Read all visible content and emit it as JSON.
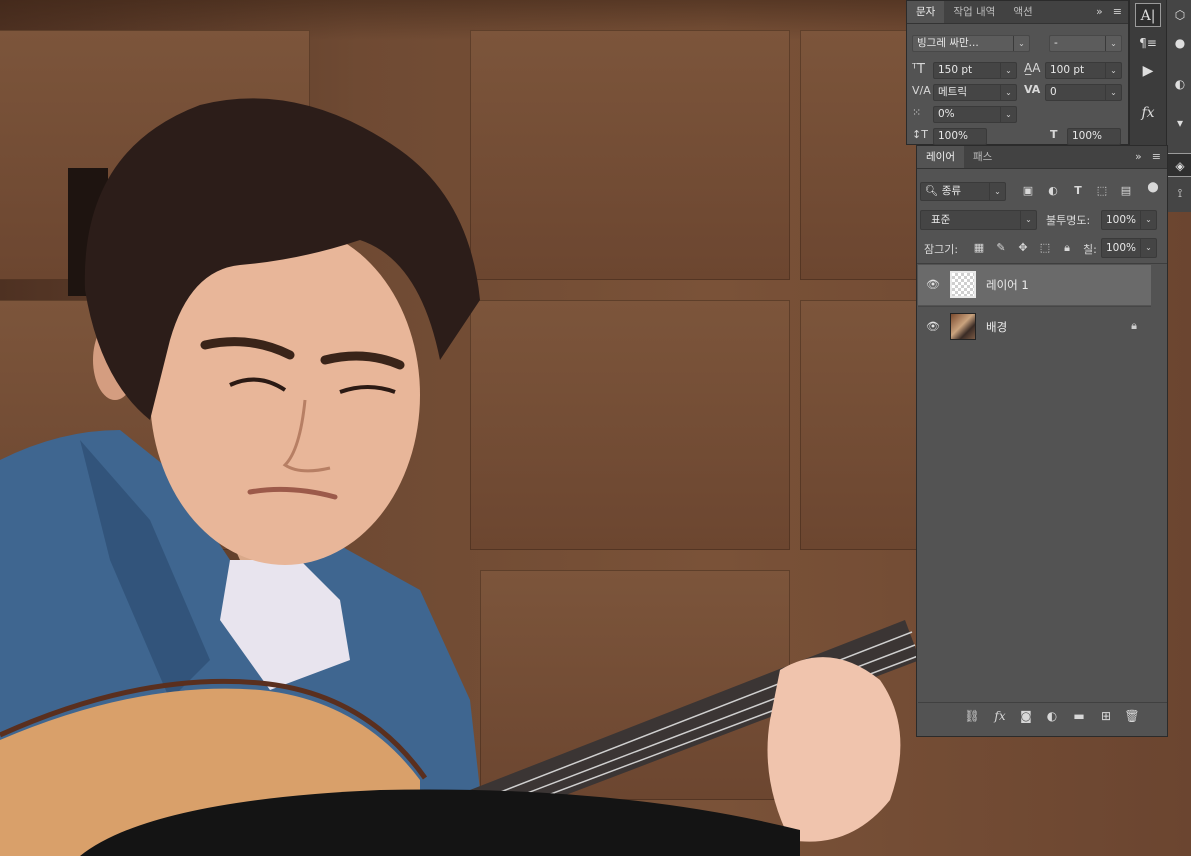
{
  "character_panel": {
    "tabs": [
      {
        "label": "문자",
        "active": true
      },
      {
        "label": "작업 내역",
        "active": false
      },
      {
        "label": "액션",
        "active": false
      }
    ],
    "expand_icon": "double-chevron-icon",
    "menu_icon": "panel-menu-icon",
    "font_family": "빙그레 싸만...",
    "font_style": "-",
    "font_size": "150 pt",
    "leading": "100 pt",
    "kerning": "메트릭",
    "tracking": "0",
    "tsume": "0%",
    "vertical_scale": "100%",
    "horizontal_scale": "100%"
  },
  "layers_panel": {
    "tabs": [
      {
        "label": "레이어",
        "active": true
      },
      {
        "label": "패스",
        "active": false
      }
    ],
    "filter_kind": "종류",
    "blend_mode": "표준",
    "opacity_label": "불투명도:",
    "opacity_value": "100%",
    "lock_label": "잠그기:",
    "fill_label": "칠:",
    "fill_value": "100%",
    "layers": [
      {
        "name": "레이어 1",
        "selected": true,
        "locked": false,
        "thumb": "transparent"
      },
      {
        "name": "배경",
        "selected": false,
        "locked": true,
        "thumb": "photo"
      }
    ],
    "bottom_icons": [
      "link-layers-icon",
      "fx-icon",
      "add-mask-icon",
      "adjustment-layer-icon",
      "new-group-icon",
      "new-layer-icon",
      "delete-layer-icon"
    ]
  },
  "toolstrip": {
    "tools": [
      "character-panel-icon",
      "paragraph-panel-icon",
      "play-action-icon",
      "fx-styles-icon"
    ],
    "far_right": [
      "3d-cube-icon",
      "color-icon",
      "adjustments-icon",
      "brush-icon",
      "layers-icon",
      "paths-icon"
    ]
  },
  "colors": {
    "panel_bg": "#535353",
    "tab_bg": "#424242",
    "selected_layer": "#6a6a6a",
    "field_bg": "#454545"
  }
}
